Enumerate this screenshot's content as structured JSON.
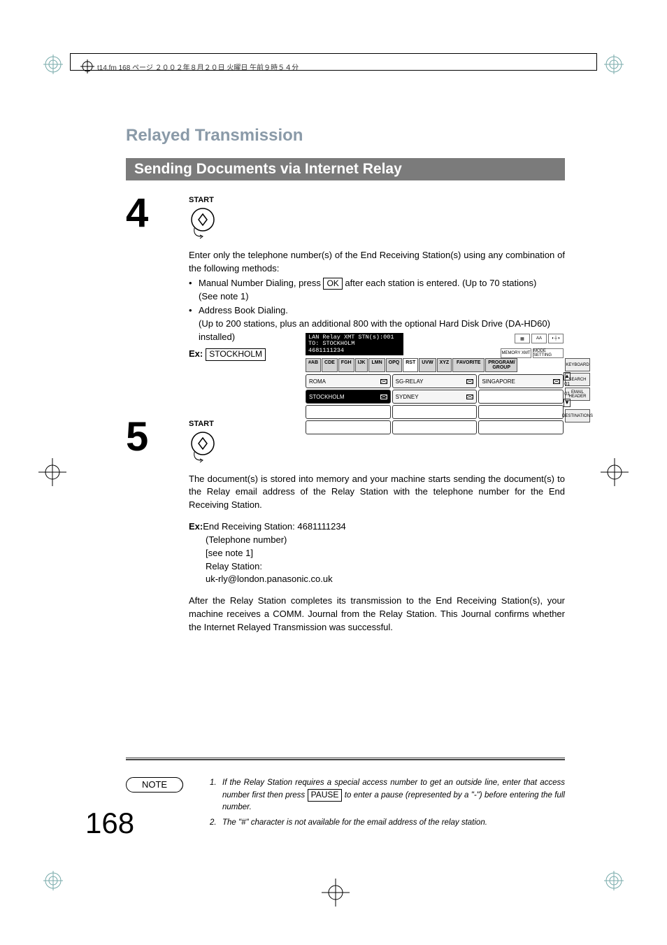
{
  "header_jp": "t14.fm  168 ページ  ２００２年８月２０日  火曜日  午前９時５４分",
  "main_header": "Relayed Transmission",
  "sub_header": "Sending Documents via Internet Relay",
  "steps": {
    "s4": {
      "num": "4",
      "start": "START",
      "intro": "Enter only the telephone number(s) of the End Receiving Station(s) using any combination of the following methods:",
      "b1a": "Manual Number Dialing, press ",
      "b1_ok": "OK",
      "b1b": " after each station is entered. (Up to 70 stations)",
      "b1_note": "(See note 1)",
      "b2": "Address Book Dialing.",
      "b2_sub": "(Up to 200 stations, plus an additional 800 with the optional Hard Disk Drive (DA-HD60) installed)",
      "ex_label": "Ex:",
      "ex_value": "STOCKHOLM"
    },
    "s5": {
      "num": "5",
      "start": "START",
      "p1": "The document(s) is stored into memory and your machine starts sending the document(s) to the Relay email address of the Relay Station with the telephone number for the End Receiving Station.",
      "ex_label": "Ex:",
      "ex1": "End Receiving Station: 4681111234",
      "ex2": "(Telephone number)",
      "ex3": "[see note 1]",
      "ex4": "Relay Station:",
      "ex5": "uk-rly@london.panasonic.co.uk",
      "p2": "After the Relay Station completes its transmission to the End Receiving Station(s), your machine receives a COMM. Journal from the Relay Station. This Journal confirms whether the Internet Relayed Transmission was successful."
    }
  },
  "screen": {
    "line1": "LAN Relay XMT STN(s):001",
    "line2": "TO: STOCKHOLM",
    "line3": "4681111234",
    "top_icons": {
      "b1": "MEMORY XMT",
      "b2": "MODE SETTING"
    },
    "tabs": [
      "#AB",
      "CDE",
      "FGH",
      "IJK",
      "LMN",
      "OPQ",
      "RST",
      "UVW",
      "XYZ"
    ],
    "fav": "FAVORITE",
    "prog": "PROGRAM/\nGROUP",
    "cells": {
      "r0": [
        "ROMA",
        "SG-RELAY",
        "SINGAPORE"
      ],
      "r1": [
        "STOCKHOLM",
        "SYDNEY",
        ""
      ]
    },
    "side": [
      "KEYBOARD",
      "SEARCH",
      "EMAIL HEADER",
      "DESTINATIONS"
    ],
    "scroll": {
      "n1": "01",
      "n2": "01"
    }
  },
  "note_badge": "NOTE",
  "notes": {
    "n1a": "If the Relay Station requires a special access number to get an outside line, enter that access number first then press ",
    "n1_pause": "PAUSE",
    "n1b": " to enter a pause (represented by a \"-\") before entering the full number.",
    "n2": "The \"#\" character is not available for the email address of the relay station."
  },
  "page_num": "168"
}
